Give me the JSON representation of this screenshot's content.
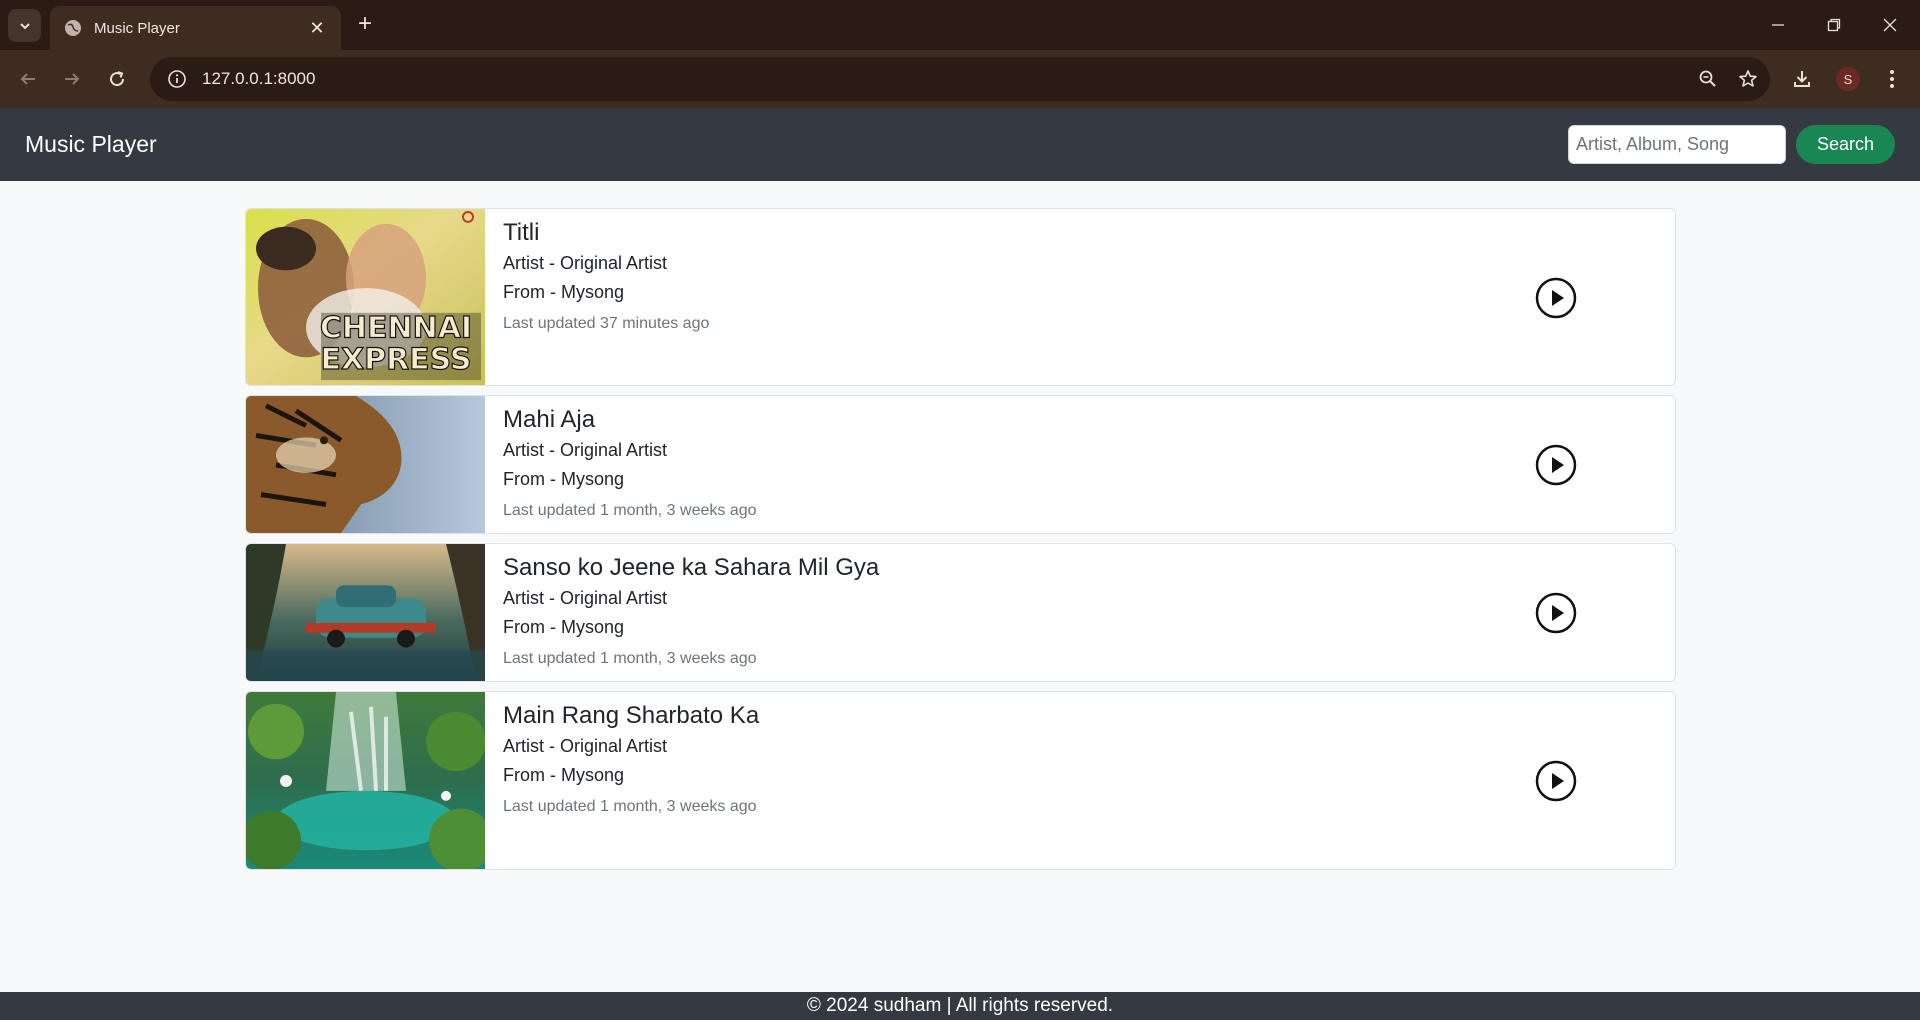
{
  "browser": {
    "tab_title": "Music Player",
    "url": "127.0.0.1:8000",
    "profile_initial": "S"
  },
  "navbar": {
    "brand": "Music Player",
    "search_placeholder": "Artist, Album, Song",
    "search_label": "Search",
    "accent_color": "#198754"
  },
  "songs": [
    {
      "title": "Titli",
      "artist": "Artist - Original Artist",
      "from": "From - Mysong",
      "updated": "Last updated 37 minutes ago",
      "cover_text_1": "CHENNAI",
      "cover_text_2": "EXPRESS"
    },
    {
      "title": "Mahi Aja",
      "artist": "Artist - Original Artist",
      "from": "From - Mysong",
      "updated": "Last updated 1 month, 3 weeks ago"
    },
    {
      "title": "Sanso ko Jeene ka Sahara Mil Gya",
      "artist": "Artist - Original Artist",
      "from": "From - Mysong",
      "updated": "Last updated 1 month, 3 weeks ago"
    },
    {
      "title": "Main Rang Sharbato Ka",
      "artist": "Artist - Original Artist",
      "from": "From - Mysong",
      "updated": "Last updated 1 month, 3 weeks ago"
    }
  ],
  "footer": {
    "text": "© 2024 sudham | All rights reserved."
  }
}
